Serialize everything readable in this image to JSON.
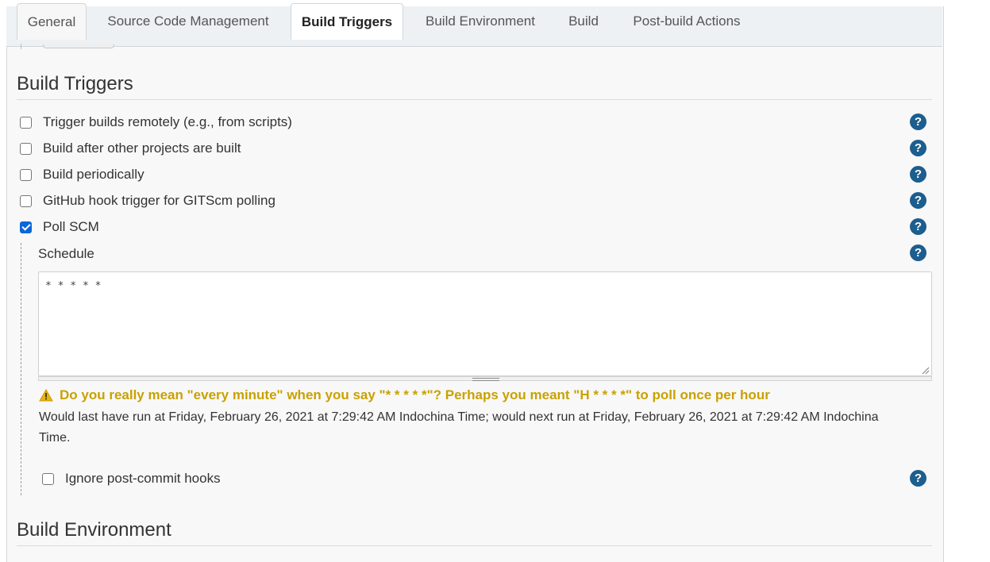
{
  "tabs": [
    {
      "label": "General"
    },
    {
      "label": "Source Code Management"
    },
    {
      "label": "Build Triggers",
      "active": true
    },
    {
      "label": "Build Environment"
    },
    {
      "label": "Build"
    },
    {
      "label": "Post-build Actions"
    }
  ],
  "build_triggers": {
    "title": "Build Triggers",
    "options": [
      {
        "label": "Trigger builds remotely (e.g., from scripts)",
        "checked": false
      },
      {
        "label": "Build after other projects are built",
        "checked": false
      },
      {
        "label": "Build periodically",
        "checked": false
      },
      {
        "label": "GitHub hook trigger for GITScm polling",
        "checked": false
      },
      {
        "label": "Poll SCM",
        "checked": true
      }
    ],
    "poll_scm": {
      "schedule_label": "Schedule",
      "schedule_value": "* * * * *",
      "warning": "Do you really mean \"every minute\" when you say \"* * * * *\"? Perhaps you meant \"H * * * *\" to poll once per hour",
      "info": "Would last have run at Friday, February 26, 2021 at 7:29:42 AM Indochina Time; would next run at Friday, February 26, 2021 at 7:29:42 AM Indochina Time.",
      "ignore_hooks_label": "Ignore post-commit hooks",
      "ignore_hooks_checked": false
    }
  },
  "build_environment": {
    "title": "Build Environment"
  },
  "help_glyph": "?",
  "icons": {
    "help": "help-question-icon",
    "warning": "warning-triangle-icon",
    "grip": "resize-grip-icon"
  },
  "colors": {
    "help": "#1c5e8e",
    "warning": "#c9a100",
    "checkbox_checked": "#0b66d8"
  }
}
